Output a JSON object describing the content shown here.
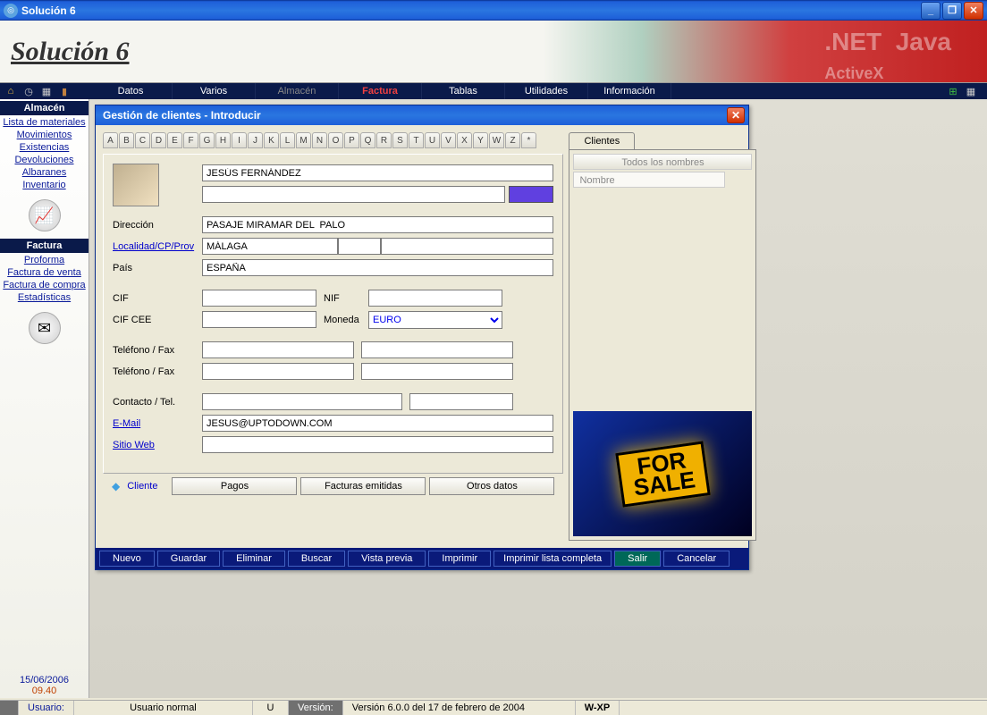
{
  "window": {
    "title": "Solución 6"
  },
  "header": {
    "title": "Solución 6"
  },
  "menu": {
    "items": [
      "Datos",
      "Varios",
      "Almacén",
      "Factura",
      "Tablas",
      "Utilidades",
      "Información"
    ],
    "active_index": 3,
    "dim_index": 2
  },
  "sidebar": {
    "section1": {
      "title": "Almacén",
      "links": [
        "Lista de materiales",
        "Movimientos",
        "Existencias",
        "Devoluciones",
        "Albaranes",
        "Inventario"
      ]
    },
    "section2": {
      "title": "Factura",
      "links": [
        "Proforma",
        "Factura de venta",
        "Factura de compra",
        "Estadísticas"
      ]
    },
    "date": "15/06/2006",
    "time": "09.40"
  },
  "dialog": {
    "title": "Gestión de clientes  -  Introducir",
    "alphabet": [
      "A",
      "B",
      "C",
      "D",
      "E",
      "F",
      "G",
      "H",
      "I",
      "J",
      "K",
      "L",
      "M",
      "N",
      "O",
      "P",
      "Q",
      "R",
      "S",
      "T",
      "U",
      "V",
      "X",
      "Y",
      "W",
      "Z",
      "*"
    ],
    "fields": {
      "name": "JESÚS FERNÁNDEZ",
      "name2": "",
      "direccion_label": "Dirección",
      "direccion": "PASAJE MIRAMAR DEL  PALO",
      "localidad_label": "Localidad/CP/Prov",
      "localidad": "MÁLAGA",
      "cp": "",
      "prov": "",
      "pais_label": "País",
      "pais": "ESPAÑA",
      "cif_label": "CIF",
      "cif": "",
      "nif_label": "NIF",
      "nif": "",
      "cifcee_label": "CIF CEE",
      "cifcee": "",
      "moneda_label": "Moneda",
      "moneda": "EURO",
      "tel1_label": "Teléfono / Fax",
      "tel1a": "",
      "tel1b": "",
      "tel2_label": "Teléfono / Fax",
      "tel2a": "",
      "tel2b": "",
      "contacto_label": "Contacto / Tel.",
      "contacto": "",
      "contacto_tel": "",
      "email_label": "E-Mail",
      "email": "JESUS@UPTODOWN.COM",
      "web_label": "Sitio Web",
      "web": ""
    },
    "cliente_label": "Cliente",
    "tabs": [
      "Pagos",
      "Facturas emitidas",
      "Otros datos"
    ],
    "right_tab": "Clientes",
    "right_header": "Todos los nombres",
    "right_name_placeholder": "Nombre",
    "sign_line1": "FOR",
    "sign_line2": "SALE",
    "actions": [
      "Nuevo",
      "Guardar",
      "Eliminar",
      "Buscar",
      "Vista previa",
      "Imprimir",
      "Imprimir  lista completa",
      "Salir",
      "Cancelar"
    ]
  },
  "statusbar": {
    "usuario_label": "Usuario:",
    "usuario": "Usuario normal",
    "u": "U",
    "version_label": "Versión:",
    "version": "Versión 6.0.0 del 17 de febrero de 2004",
    "os": "W-XP"
  }
}
